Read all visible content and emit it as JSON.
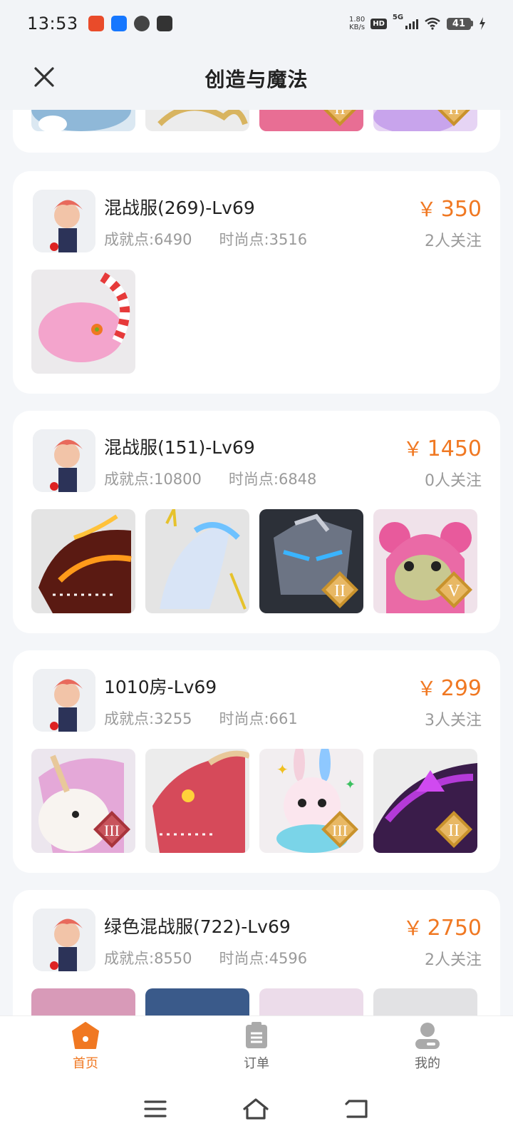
{
  "status_bar": {
    "time": "13:53",
    "net_speed_value": "1.80",
    "net_speed_unit": "KB/s",
    "hd_label": "HD",
    "network": "5G",
    "battery": "41"
  },
  "header": {
    "title": "创造与魔法",
    "close_icon": "close-icon"
  },
  "listings": [
    {
      "name": "混战服(269)-Lv69",
      "achievement": "成就点:6490",
      "fashion": "时尚点:3516",
      "price_symbol": "￥",
      "price": "350",
      "followers": "2人关注",
      "thumbs": [
        "pink-striped-dragon"
      ]
    },
    {
      "name": "混战服(151)-Lv69",
      "achievement": "成就点:10800",
      "fashion": "时尚点:6848",
      "price_symbol": "￥",
      "price": "1450",
      "followers": "0人关注",
      "thumbs": [
        "fire-dragon",
        "ice-dragon",
        "stone-golem",
        "pink-bear"
      ],
      "badges": [
        "",
        "",
        "II",
        "V"
      ]
    },
    {
      "name": "1010房-Lv69",
      "achievement": "成就点:3255",
      "fashion": "时尚点:661",
      "price_symbol": "￥",
      "price": "299",
      "followers": "3人关注",
      "thumbs": [
        "unicorn",
        "red-dragon",
        "rabbit",
        "purple-dragon"
      ],
      "badges": [
        "III",
        "",
        "III",
        "II"
      ]
    },
    {
      "name": "绿色混战服(722)-Lv69",
      "achievement": "成就点:8550",
      "fashion": "时尚点:4596",
      "price_symbol": "￥",
      "price": "2750",
      "followers": "2人关注"
    }
  ],
  "top_partial_badges": [
    "II",
    "II"
  ],
  "bottom_nav": [
    {
      "label": "首页",
      "icon": "home-icon",
      "active": true
    },
    {
      "label": "订单",
      "icon": "order-icon",
      "active": false
    },
    {
      "label": "我的",
      "icon": "profile-icon",
      "active": false
    }
  ],
  "colors": {
    "accent": "#f07822",
    "price": "#f07822",
    "muted": "#9a9a9a",
    "background": "#f4f6f9"
  }
}
